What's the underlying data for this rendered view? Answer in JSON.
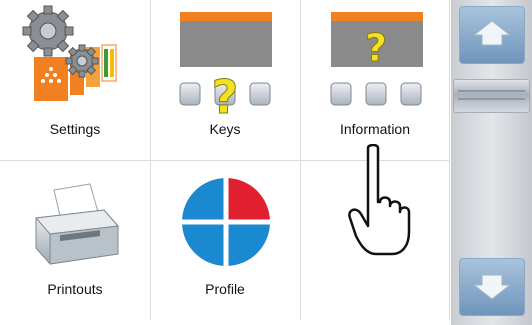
{
  "tiles": {
    "settings": {
      "label": "Settings",
      "icon": "gears-icon"
    },
    "keys": {
      "label": "Keys",
      "icon": "keys-help-icon"
    },
    "information": {
      "label": "Information",
      "icon": "information-help-icon"
    },
    "printouts": {
      "label": "Printouts",
      "icon": "printer-icon"
    },
    "profile": {
      "label": "Profile",
      "icon": "profile-pie-icon"
    },
    "empty": {
      "label": ""
    }
  },
  "pointer": {
    "icon": "hand-pointer-icon"
  },
  "scrollbar": {
    "up_icon": "scroll-up-icon",
    "down_icon": "scroll-down-icon"
  },
  "colors": {
    "accent_orange": "#f08020",
    "question_yellow": "#f2e21f",
    "profile_blue": "#1a89cf",
    "profile_red": "#e0202e",
    "scroll_blue": "#7a9fc6"
  }
}
